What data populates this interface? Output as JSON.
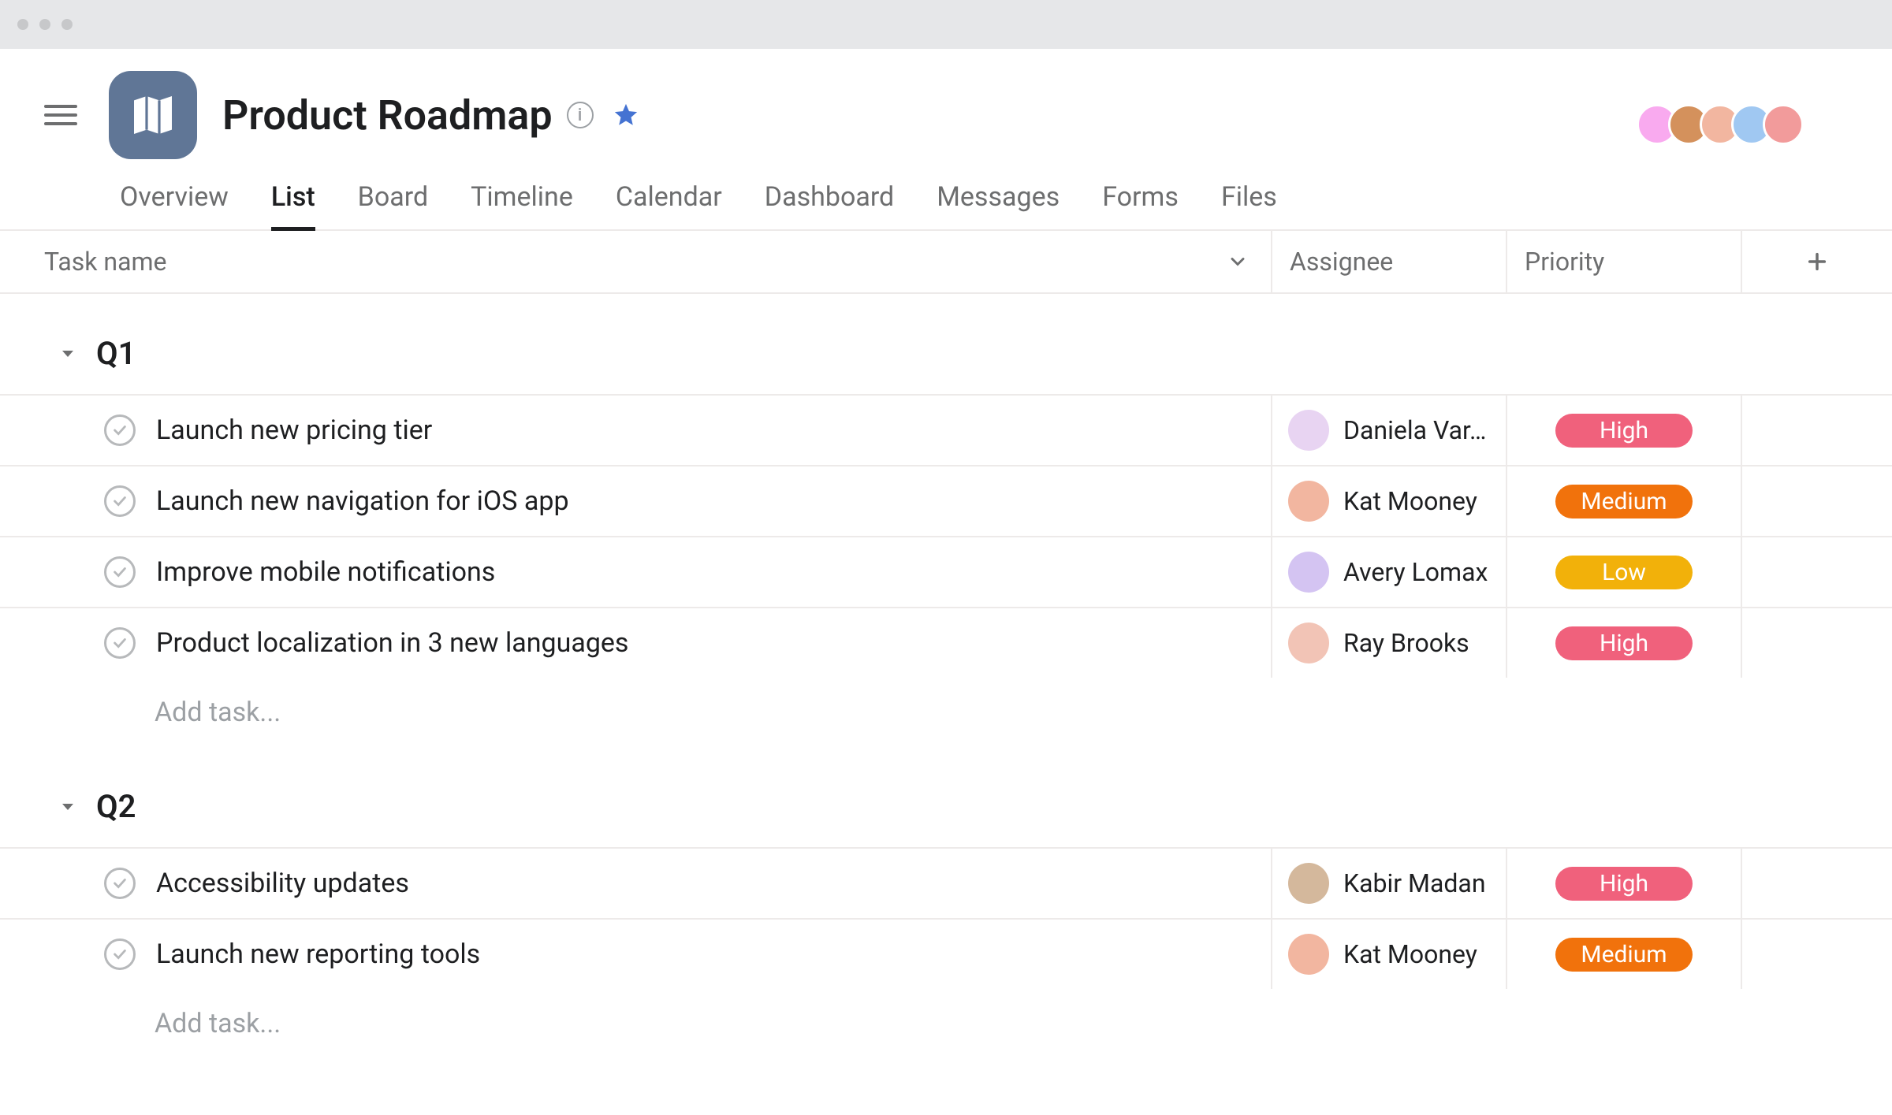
{
  "header": {
    "project_title": "Product Roadmap"
  },
  "tabs": [
    {
      "label": "Overview",
      "active": false
    },
    {
      "label": "List",
      "active": true
    },
    {
      "label": "Board",
      "active": false
    },
    {
      "label": "Timeline",
      "active": false
    },
    {
      "label": "Calendar",
      "active": false
    },
    {
      "label": "Dashboard",
      "active": false
    },
    {
      "label": "Messages",
      "active": false
    },
    {
      "label": "Forms",
      "active": false
    },
    {
      "label": "Files",
      "active": false
    }
  ],
  "columns": {
    "task": "Task name",
    "assignee": "Assignee",
    "priority": "Priority"
  },
  "member_avatar_colors": [
    "#f9aaef",
    "#d4915c",
    "#f2b6a0",
    "#a0c8f2",
    "#f29b9b"
  ],
  "priority_colors": {
    "High": "#f0617c",
    "Medium": "#f1720c",
    "Low": "#f2b10a"
  },
  "assignee_colors": {
    "Daniela Var…": "#e8d4f2",
    "Kat Mooney": "#f2b6a0",
    "Avery Lomax": "#d4c4f2",
    "Ray Brooks": "#f2c4b6",
    "Kabir Madan": "#d4b89c"
  },
  "sections": [
    {
      "title": "Q1",
      "tasks": [
        {
          "name": "Launch new pricing tier",
          "assignee": "Daniela Var…",
          "priority": "High"
        },
        {
          "name": "Launch new navigation for iOS app",
          "assignee": "Kat Mooney",
          "priority": "Medium"
        },
        {
          "name": "Improve mobile notifications",
          "assignee": "Avery Lomax",
          "priority": "Low"
        },
        {
          "name": "Product localization in 3 new languages",
          "assignee": "Ray Brooks",
          "priority": "High"
        }
      ],
      "add_task_label": "Add task..."
    },
    {
      "title": "Q2",
      "tasks": [
        {
          "name": "Accessibility updates",
          "assignee": "Kabir Madan",
          "priority": "High"
        },
        {
          "name": "Launch new reporting tools",
          "assignee": "Kat Mooney",
          "priority": "Medium"
        }
      ],
      "add_task_label": "Add task..."
    }
  ]
}
